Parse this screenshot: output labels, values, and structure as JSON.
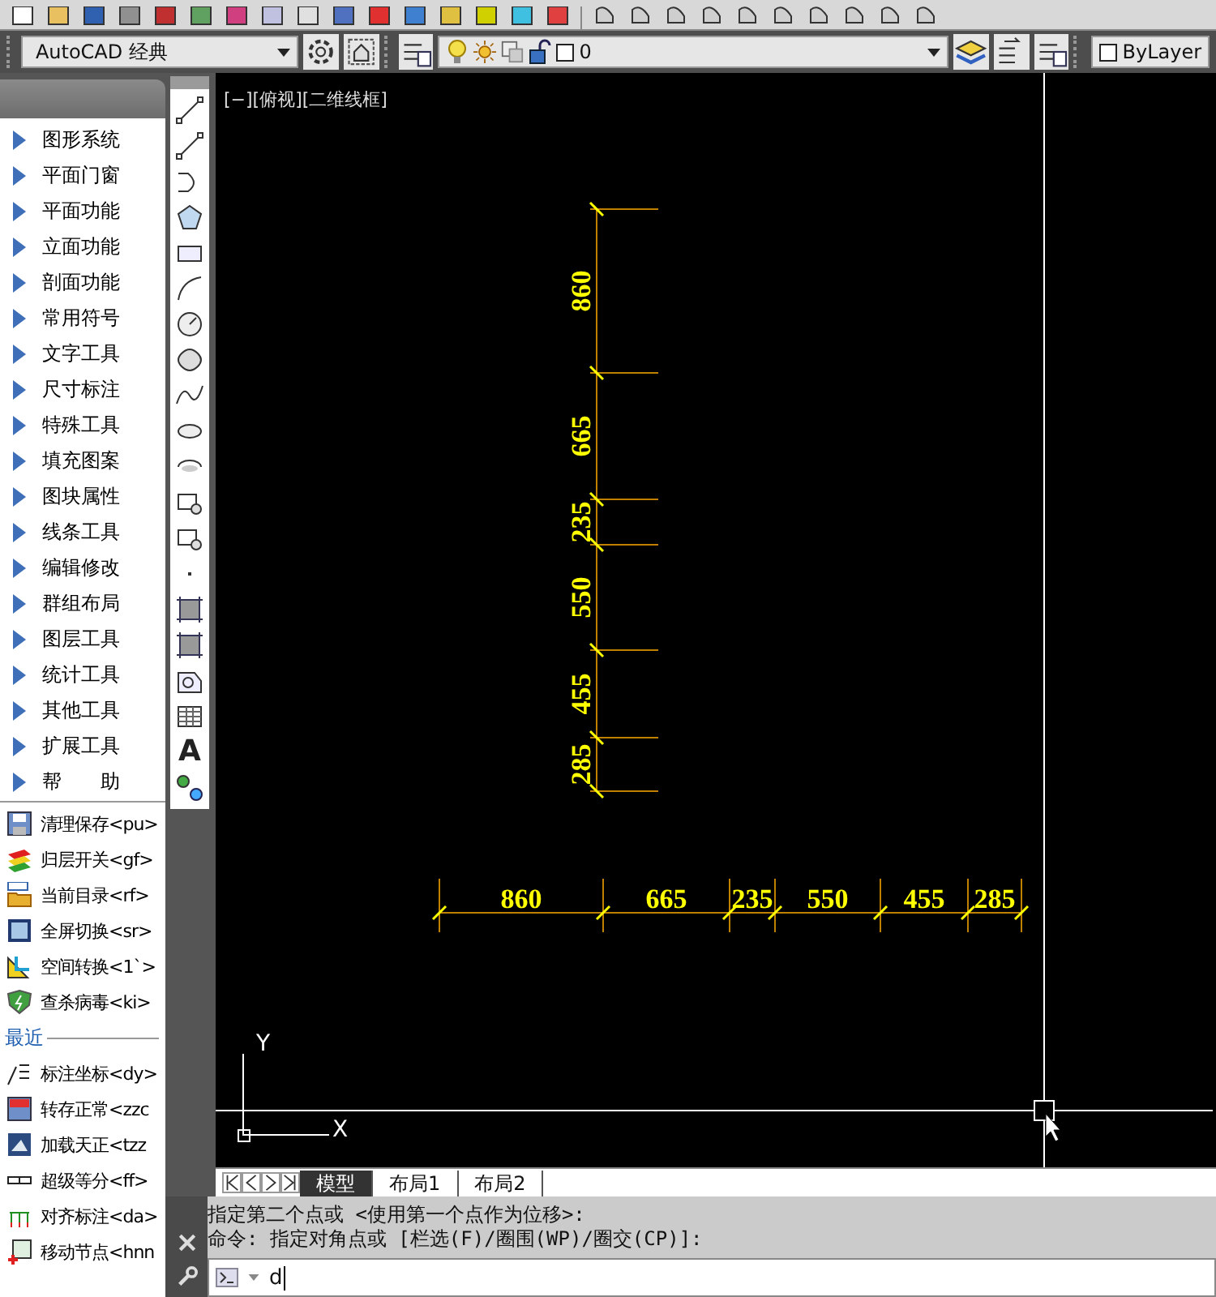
{
  "workspace": {
    "value": "AutoCAD 经典"
  },
  "layer_control": {
    "value": "0"
  },
  "color_control": {
    "value": "ByLayer"
  },
  "menu_items": [
    {
      "label": "图形系统"
    },
    {
      "label": "平面门窗"
    },
    {
      "label": "平面功能"
    },
    {
      "label": "立面功能"
    },
    {
      "label": "剖面功能"
    },
    {
      "label": "常用符号"
    },
    {
      "label": "文字工具"
    },
    {
      "label": "尺寸标注"
    },
    {
      "label": "特殊工具"
    },
    {
      "label": "填充图案"
    },
    {
      "label": "图块属性"
    },
    {
      "label": "线条工具"
    },
    {
      "label": "编辑修改"
    },
    {
      "label": "群组布局"
    },
    {
      "label": "图层工具"
    },
    {
      "label": "统计工具"
    },
    {
      "label": "其他工具"
    },
    {
      "label": "扩展工具"
    },
    {
      "label": "帮　　助"
    }
  ],
  "tool_items": [
    {
      "kind": "save",
      "label": "清理保存<pu>"
    },
    {
      "kind": "layers",
      "label": "归层开关<gf>"
    },
    {
      "kind": "folder",
      "label": "当前目录<rf>"
    },
    {
      "kind": "fullscreen",
      "label": "全屏切换<sr>"
    },
    {
      "kind": "ucs",
      "label": "空间转换<1`>"
    },
    {
      "kind": "shield",
      "label": "查杀病毒<ki>"
    }
  ],
  "recent_heading": "最近",
  "recent_items": [
    {
      "kind": "dimension",
      "label": "标注坐标<dy>"
    },
    {
      "kind": "tch",
      "label": "转存正常<zzc"
    },
    {
      "kind": "load",
      "label": "加载天正<tzz"
    },
    {
      "kind": "divide",
      "label": "超级等分<ff>"
    },
    {
      "kind": "align",
      "label": "对齐标注<da>"
    },
    {
      "kind": "move",
      "label": "移动节点<hnn"
    }
  ],
  "text_tool_glyph": "A",
  "viewport_label": "[−][俯视][二维线框]",
  "vertical_dimensions": [
    "860",
    "665",
    "235",
    "550",
    "455",
    "285"
  ],
  "horizontal_dimensions": [
    "860",
    "665",
    "235",
    "550",
    "455",
    "285"
  ],
  "ucs": {
    "y_label": "Y",
    "x_label": "X"
  },
  "layout_tabs": [
    {
      "label": "模型",
      "selected": true
    },
    {
      "label": "布局1",
      "selected": false
    },
    {
      "label": "布局2",
      "selected": false
    }
  ],
  "command_history": [
    "指定第二个点或 <使用第一个点作为位移>:",
    "命令: 指定对角点或 [栏选(F)/圈围(WP)/圈交(CP)]:"
  ],
  "command_input": {
    "value": "d"
  }
}
